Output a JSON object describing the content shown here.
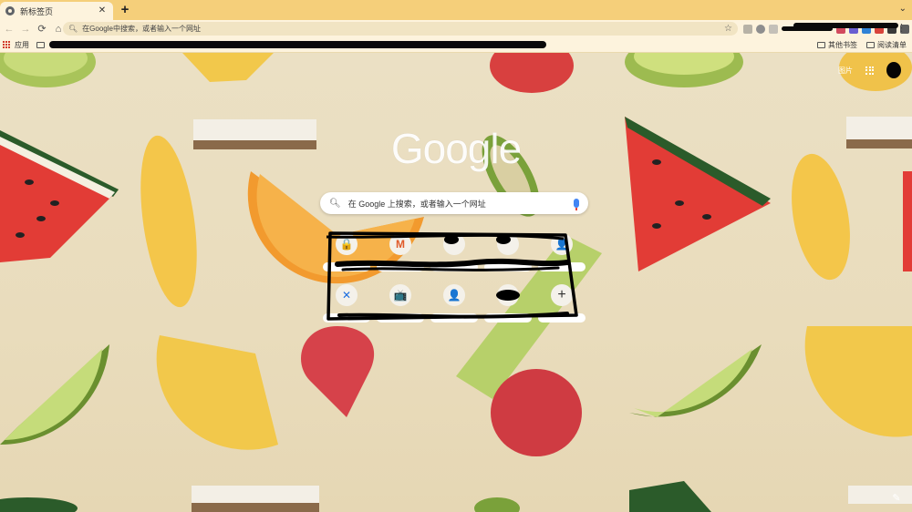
{
  "tab": {
    "title": "新标签页",
    "close": "✕",
    "new_tab": "+",
    "menu": "⌄"
  },
  "toolbar": {
    "back": "←",
    "forward": "→",
    "reload": "⟳",
    "home": "⌂",
    "omnibox_placeholder": "在Google中搜索，或者输入一个网址",
    "star": "☆",
    "menu": "⋮",
    "extension_colors": [
      "#b7b2a6",
      "#8e8e8e",
      "#c4c0b8",
      "#d24a5e",
      "#6a5fd1",
      "#2f82d6",
      "#d8443a",
      "#3a3a3a",
      "#5e5e5e",
      "#6e4fd6"
    ]
  },
  "bookmarks": {
    "apps_label": "应用",
    "other_bookmarks": "其他书签",
    "reading_list": "阅读清单"
  },
  "ntp": {
    "images_link": "图片",
    "logo": "Google",
    "search_placeholder": "在 Google 上搜索，或者输入一个网址",
    "shortcuts": [
      {
        "icon": "🔒",
        "label": ""
      },
      {
        "icon": "M",
        "label": ""
      },
      {
        "icon": "",
        "label": ""
      },
      {
        "icon": "",
        "label": ""
      },
      {
        "icon": "👤",
        "label": ""
      },
      {
        "icon": "✕",
        "label": ""
      },
      {
        "icon": "📺",
        "label": ""
      },
      {
        "icon": "👤",
        "label": ""
      },
      {
        "icon": "",
        "label": ""
      },
      {
        "icon": "+",
        "label": ""
      }
    ],
    "customize": "✎"
  },
  "colors": {
    "tabstrip": "#f5cf7a",
    "toolbar": "#fdf3dd",
    "background": "#ebe0c4"
  }
}
